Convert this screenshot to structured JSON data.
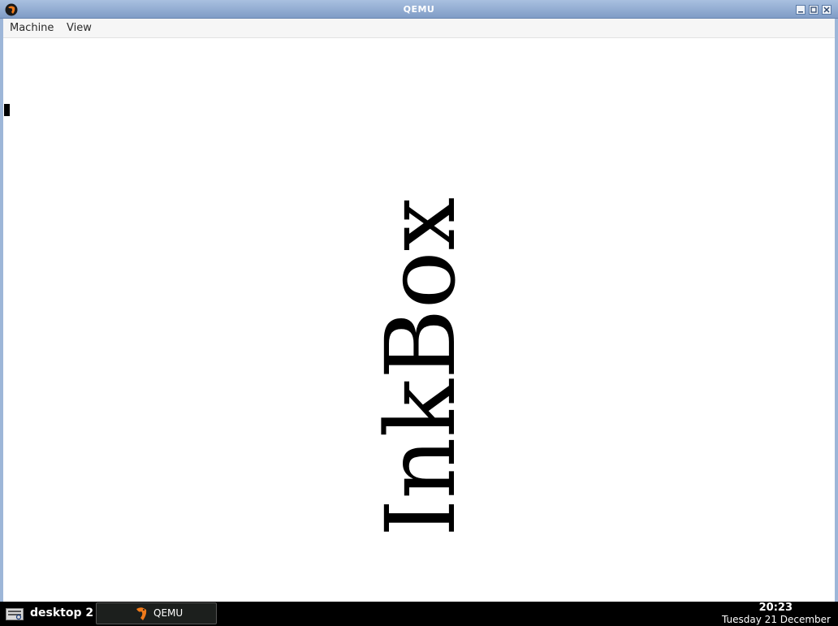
{
  "window": {
    "title": "QEMU"
  },
  "menubar": {
    "items": [
      "Machine",
      "View"
    ]
  },
  "screen": {
    "logo_text": "InkBox"
  },
  "taskbar": {
    "desktop_label": "desktop 2",
    "tasks": [
      {
        "label": "QEMU"
      }
    ],
    "clock_time": "20:23",
    "clock_date": "Tuesday 21 December"
  },
  "icons": {
    "app_icon": "qemu-icon",
    "minimize": "minimize-icon",
    "maximize": "maximize-icon",
    "close": "close-icon",
    "start_menu": "menu-icon"
  },
  "colors": {
    "titlebar": "#7f9cc6",
    "qemu_orange": "#f07a1a",
    "taskbar": "#000000"
  }
}
